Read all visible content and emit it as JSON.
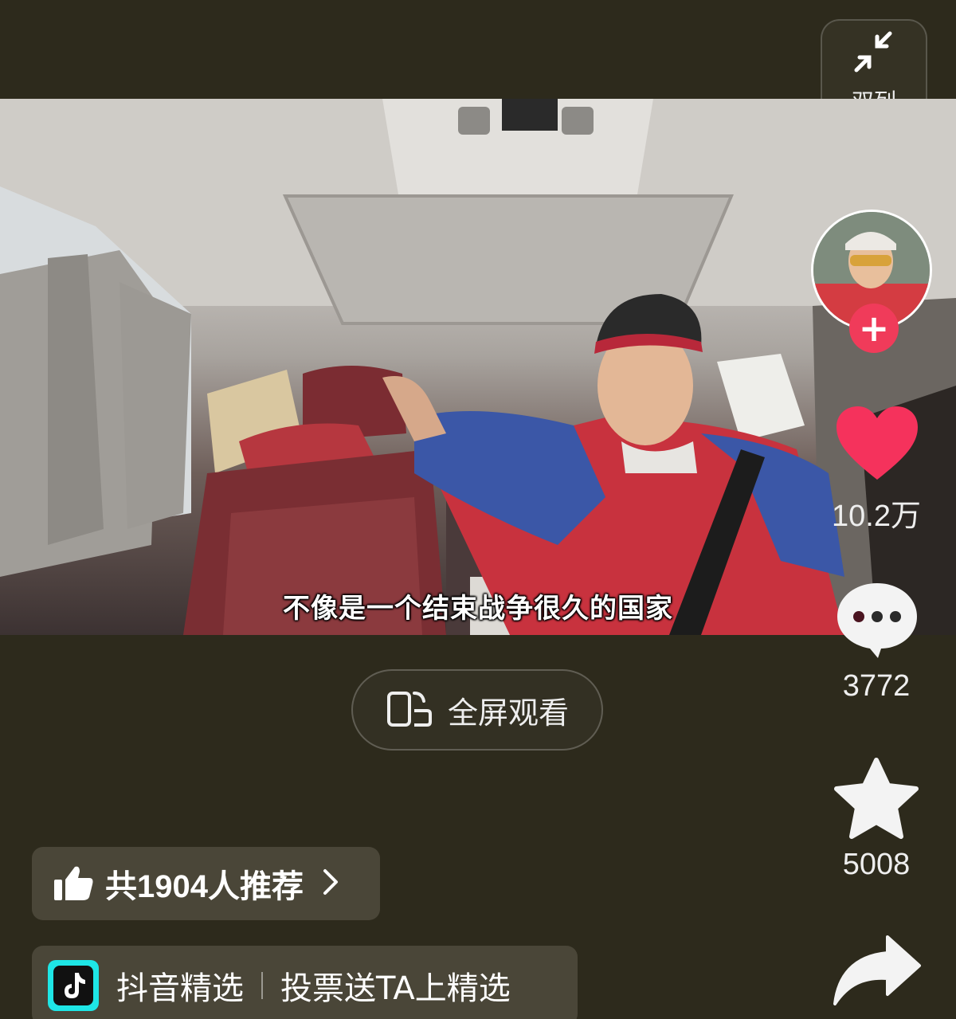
{
  "top_bar": {
    "dual_column_label": "双列",
    "dual_column_icon": "collapse-arrows-icon"
  },
  "video": {
    "subtitle": "不像是一个结束战争很久的国家"
  },
  "right_rail": {
    "avatar_icon": "creator-avatar",
    "follow_icon": "plus-icon",
    "like_count": "10.2万",
    "comment_count": "3772",
    "favorite_count": "5008",
    "colors": {
      "like": "#f5325c",
      "follow": "#f03b5a"
    }
  },
  "fullscreen": {
    "label": "全屏观看",
    "icon": "rotate-phone-icon"
  },
  "recommend": {
    "label": "共1904人推荐",
    "icon": "thumbs-up-icon"
  },
  "douyin": {
    "brand": "抖音精选",
    "action": "投票送TA上精选",
    "icon": "douyin-logo"
  }
}
